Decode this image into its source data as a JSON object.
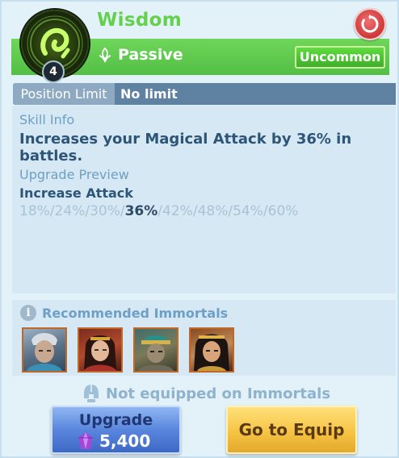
{
  "header": {
    "title": "Wisdom",
    "level": "4",
    "type_label": "Passive",
    "rarity": "Uncommon"
  },
  "position_limit": {
    "label": "Position Limit",
    "value": "No limit"
  },
  "skill_info": {
    "label": "Skill Info",
    "description": "Increases your Magical Attack by 36% in battles."
  },
  "upgrade_preview": {
    "label": "Upgrade Preview",
    "stat": "Increase Attack",
    "levels": [
      "18%",
      "24%",
      "30%",
      "36%",
      "42%",
      "48%",
      "54%",
      "60%"
    ],
    "current_index": 3
  },
  "recommended": {
    "label": "Recommended Immortals"
  },
  "footer": {
    "status": "Not equipped on Immortals",
    "upgrade_label": "Upgrade",
    "upgrade_cost": "5,400",
    "equip_label": "Go to Equip"
  },
  "colors": {
    "title_green": "#63d14b",
    "bar_green": "#5cc94c",
    "rarity_green": "#4cc232",
    "upgrade_blue": "#5a86de",
    "equip_gold": "#f6c445"
  },
  "icons": {
    "refresh": "refresh-icon",
    "passive": "leaf-icon",
    "info": "info-icon",
    "helmet": "helmet-icon",
    "currency": "purple-gem-icon"
  }
}
